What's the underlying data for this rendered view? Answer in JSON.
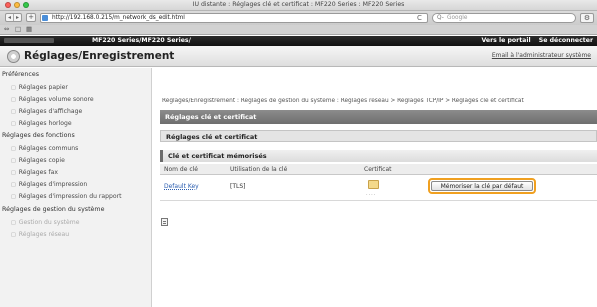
{
  "window": {
    "title": "IU distante : Réglages clé et certificat : MF220 Series : MF220 Series"
  },
  "toolbar": {
    "back_icon": "back-arrow-icon",
    "forward_icon": "forward-arrow-icon",
    "add_label": "+",
    "url": "http://192.168.0.215/m_network_ds_edit.html",
    "reload_glyph": "C",
    "search_placeholder": "Google",
    "search_prefix": "Q-"
  },
  "bookmarks": {
    "reader": "⇔",
    "book": "□",
    "grid": "▦"
  },
  "topband": {
    "device": "MF220 Series/MF220 Series/",
    "portal_link": "Vers le portail",
    "logout_link": "Se déconnecter"
  },
  "header": {
    "title": "Réglages/Enregistrement",
    "mail_link": "Email à l'administrateur système"
  },
  "sidebar": {
    "section_prefs": "Préférences",
    "prefs_items": [
      "Réglages papier",
      "Réglages volume sonore",
      "Réglages d'affichage",
      "Réglages horloge"
    ],
    "section_functions": "Réglages des fonctions",
    "function_items": [
      "Réglages communs",
      "Réglages copie",
      "Réglages fax",
      "Réglages d'impression",
      "Réglages d'impression du rapport"
    ],
    "section_system": "Réglages de gestion du système",
    "system_items": [
      "Gestion du système",
      "Réglages réseau"
    ]
  },
  "main": {
    "breadcrumb": "Réglages/Enregistrement : Réglages de gestion du système : Réglages réseau > Réglages TCP/IP > Réglages clé et certificat",
    "panel_title": "Réglages clé et certificat",
    "section_title": "Réglages clé et certificat",
    "subsection_title": "Clé et certificat mémorisés",
    "columns": [
      "Nom de clé",
      "Utilisation de la clé",
      "Certificat"
    ],
    "rows": [
      {
        "key_name": "Default Key",
        "usage": "[TLS]",
        "cert_icon": "certificate-icon",
        "button": "Mémoriser la clé par défaut"
      }
    ]
  },
  "colors": {
    "highlight": "#f0a020",
    "panel_header": "#7a7a7a",
    "topband": "#1a1a1a",
    "link": "#2a5db0"
  }
}
